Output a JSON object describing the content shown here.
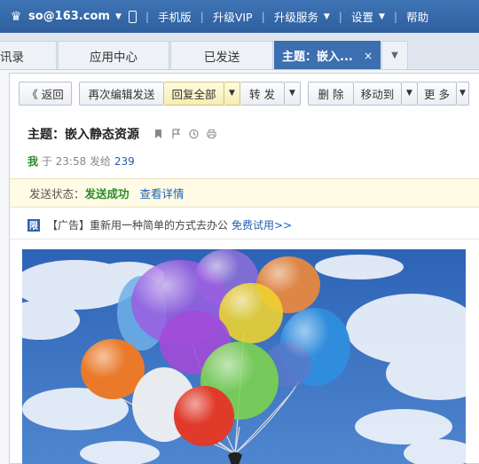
{
  "topbar": {
    "email": "so@163.com",
    "mobile": "手机版",
    "vip": "升级VIP",
    "upgrade": "升级服务",
    "settings": "设置",
    "help": "帮助"
  },
  "tabs": [
    {
      "label": "讯录"
    },
    {
      "label": "应用中心"
    },
    {
      "label": "已发送"
    },
    {
      "label": "主题：嵌入...",
      "close": "×"
    }
  ],
  "toolbar": {
    "back": "《 返回",
    "reedit": "再次编辑发送",
    "reply_all": "回复全部",
    "forward": "转 发",
    "delete": "删 除",
    "move": "移动到",
    "more": "更 多"
  },
  "message": {
    "subject": "主题：嵌入静态资源",
    "sender_me": "我",
    "sender_rest": " 于 23:58 发给 ",
    "recipient": "239",
    "status_label": "发送状态：",
    "status_value": "发送成功",
    "status_detail": "查看详情"
  },
  "ad": {
    "badge": "限",
    "text": "【广告】重新用一种简单的方式去办公",
    "link": "免费试用>>"
  },
  "colors": {
    "topbar": "#2f5f9e",
    "active_tab": "#3b6fb0",
    "status_bg": "#fffbe6",
    "success": "#2a8a2a",
    "link": "#2060b0"
  }
}
